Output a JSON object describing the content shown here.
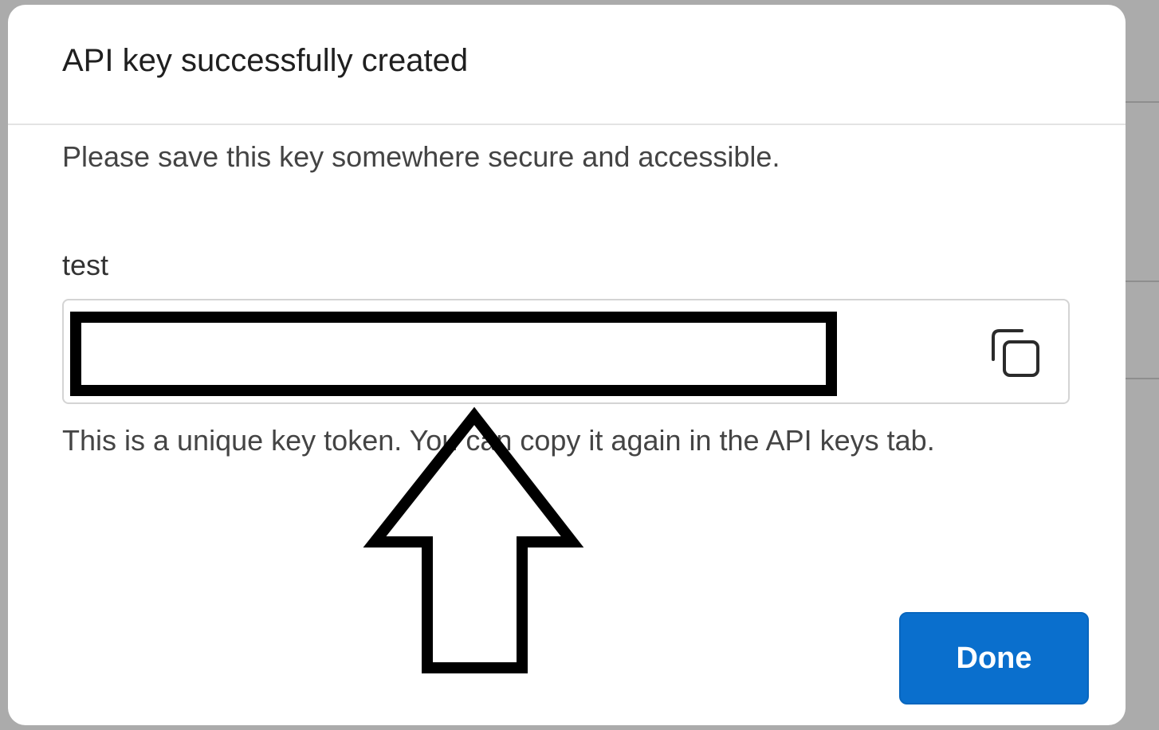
{
  "dialog": {
    "title": "API key successfully created",
    "intro": "Please save this key somewhere secure and accessible.",
    "key_name": "test",
    "key_value_state": "redacted",
    "copy_icon": "copy-icon",
    "helper": "This is a unique key token. You can copy it again in the API keys tab.",
    "done_label": "Done"
  },
  "annotation": {
    "shape": "up-arrow-outline",
    "color": "#000000"
  },
  "colors": {
    "primary_button": "#0a6fcd",
    "backdrop": "#ababab"
  }
}
